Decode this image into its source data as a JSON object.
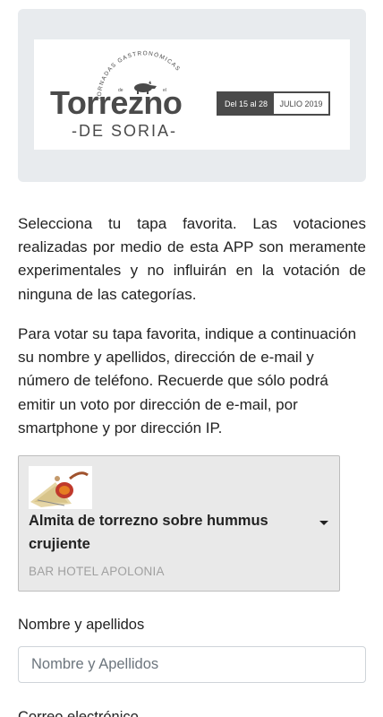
{
  "banner": {
    "arc_text": "JORNADAS GASTRONÓMICAS",
    "arc_small_left": "de",
    "arc_small_right": "el",
    "title": "Torrezno",
    "subtitle": "-DE SORIA-",
    "date_range": "Del 15 al 28",
    "month_year": "JULIO 2019",
    "bg_color": "#e8ebee",
    "logo_color": "#4a4a4a"
  },
  "intro": {
    "paragraph1": "Selecciona tu tapa favorita. Las votaciones realizadas por medio de esta APP son meramente experimentales y no influirán en la votación de ninguna de las categorías.",
    "paragraph2": "Para votar su tapa favorita, indique a continuación su nombre y apellidos, dirección de e-mail y número de teléfono. Recuerde que sólo podrá emitir un voto por dirección de e-mail, por smartphone y por dirección IP."
  },
  "tapa_select": {
    "selected_name": "Almita de torrezno sobre hummus crujiente",
    "selected_bar": "BAR HOTEL APOLONIA",
    "thumbnail_icon": "tapa-photo"
  },
  "form": {
    "name_label": "Nombre y apellidos",
    "name_placeholder": "Nombre y Apellidos",
    "name_value": "",
    "email_label": "Correo electrónico"
  }
}
